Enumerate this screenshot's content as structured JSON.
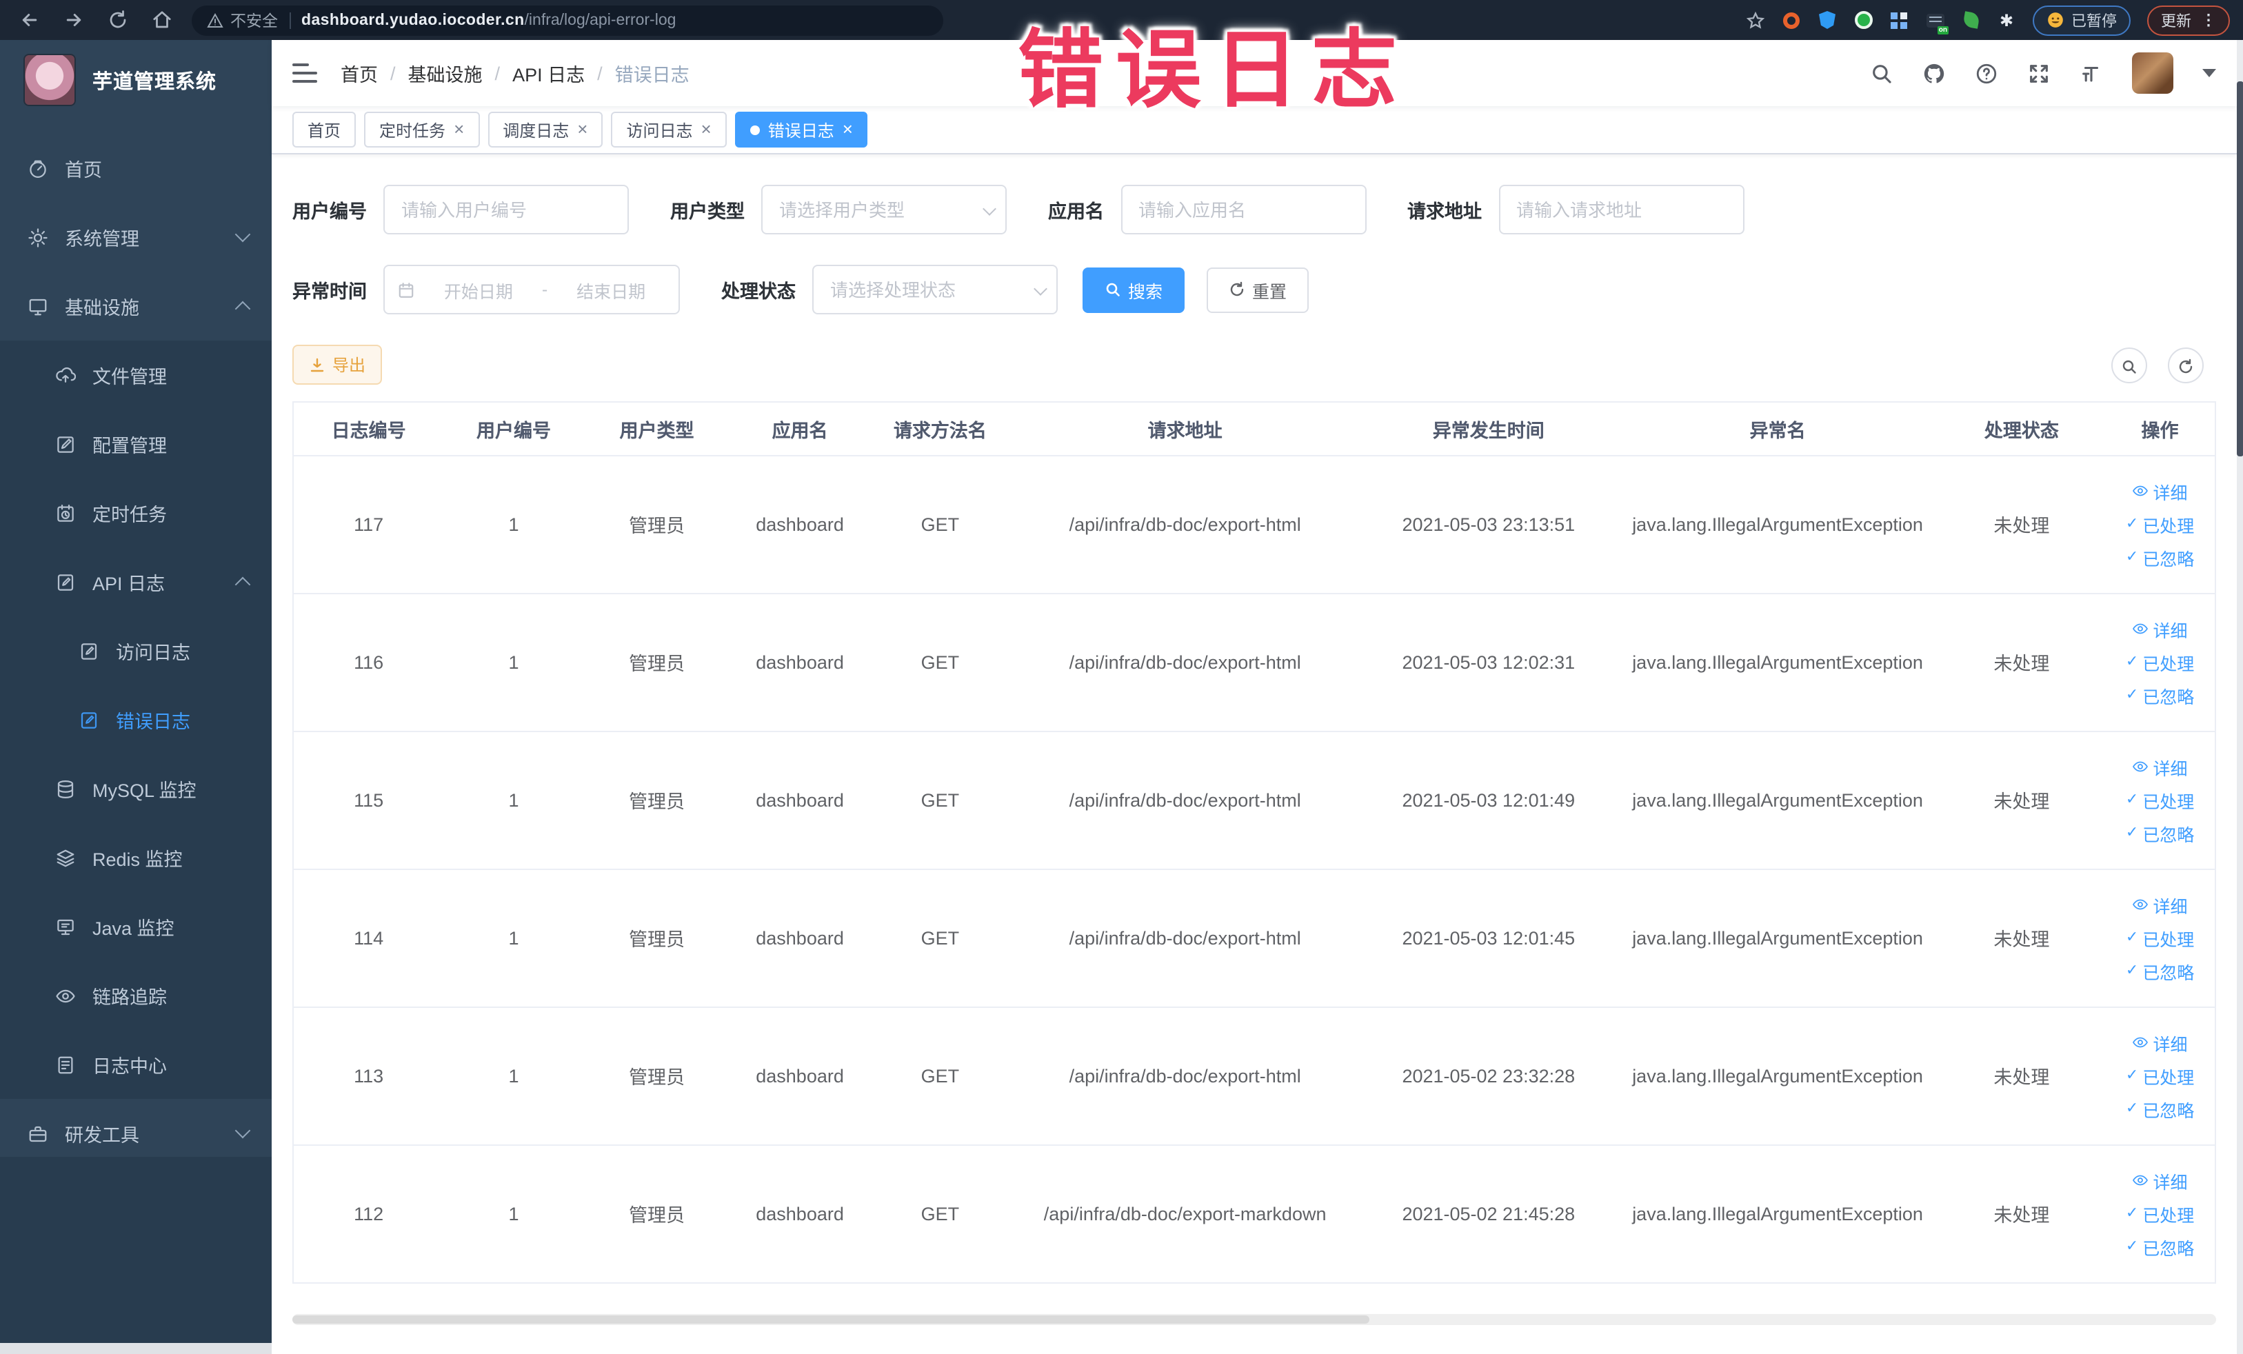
{
  "colors": {
    "accent": "#409eff",
    "warning": "#e6a23c",
    "annotation": "#ec3a5e",
    "sidebar_bg": "#2f4458",
    "submenu_bg": "#283c4f",
    "browser_bar_bg": "#1c2634"
  },
  "annotation": {
    "text": "错误日志"
  },
  "browser": {
    "security_label": "不安全",
    "url_domain": "dashboard.yudao.iocoder.cn",
    "url_path": "/infra/log/api-error-log",
    "paused_badge": "已暂停",
    "update_label": "更新"
  },
  "sidebar": {
    "logo_title": "芋道管理系统",
    "items": [
      {
        "label": "首页",
        "icon": "dashboard-icon",
        "depth": 0
      },
      {
        "label": "系统管理",
        "icon": "gear-icon",
        "depth": 0,
        "arrow": "down"
      },
      {
        "label": "基础设施",
        "icon": "monitor-icon",
        "depth": 0,
        "arrow": "up"
      },
      {
        "label": "文件管理",
        "icon": "upload-icon",
        "depth": 1,
        "sub": true
      },
      {
        "label": "配置管理",
        "icon": "edit-icon",
        "depth": 1,
        "sub": true
      },
      {
        "label": "定时任务",
        "icon": "task-icon",
        "depth": 1,
        "sub": true
      },
      {
        "label": "API 日志",
        "icon": "log-icon",
        "depth": 1,
        "sub": true,
        "arrow": "up"
      },
      {
        "label": "访问日志",
        "icon": "log-icon",
        "depth": 2,
        "sub": true
      },
      {
        "label": "错误日志",
        "icon": "log-icon",
        "depth": 2,
        "sub": true,
        "active": true
      },
      {
        "label": "MySQL 监控",
        "icon": "database-icon",
        "depth": 1,
        "sub": true
      },
      {
        "label": "Redis 监控",
        "icon": "layers-icon",
        "depth": 1,
        "sub": true
      },
      {
        "label": "Java 监控",
        "icon": "java-icon",
        "depth": 1,
        "sub": true
      },
      {
        "label": "链路追踪",
        "icon": "trace-icon",
        "depth": 1,
        "sub": true
      },
      {
        "label": "日志中心",
        "icon": "log-center-icon",
        "depth": 1,
        "sub": true
      },
      {
        "label": "研发工具",
        "icon": "toolbox-icon",
        "depth": 0,
        "arrow": "down"
      }
    ]
  },
  "breadcrumb": [
    "首页",
    "基础设施",
    "API 日志",
    "错误日志"
  ],
  "tabs": [
    {
      "label": "首页",
      "closable": false,
      "active": false
    },
    {
      "label": "定时任务",
      "closable": true,
      "active": false
    },
    {
      "label": "调度日志",
      "closable": true,
      "active": false
    },
    {
      "label": "访问日志",
      "closable": true,
      "active": false
    },
    {
      "label": "错误日志",
      "closable": true,
      "active": true
    }
  ],
  "filters": {
    "user_id_label": "用户编号",
    "user_id_placeholder": "请输入用户编号",
    "user_type_label": "用户类型",
    "user_type_placeholder": "请选择用户类型",
    "app_name_label": "应用名",
    "app_name_placeholder": "请输入应用名",
    "request_url_label": "请求地址",
    "request_url_placeholder": "请输入请求地址",
    "exception_time_label": "异常时间",
    "start_date_placeholder": "开始日期",
    "range_separator": "-",
    "end_date_placeholder": "结束日期",
    "process_status_label": "处理状态",
    "process_status_placeholder": "请选择处理状态",
    "search_button": "搜索",
    "reset_button": "重置"
  },
  "toolbar": {
    "export_label": "导出"
  },
  "table": {
    "columns": [
      {
        "label": "日志编号",
        "key": "id",
        "width": "7.8%"
      },
      {
        "label": "用户编号",
        "key": "user_id",
        "width": "7.3%"
      },
      {
        "label": "用户类型",
        "key": "user_type",
        "width": "7.6%"
      },
      {
        "label": "应用名",
        "key": "app",
        "width": "7.3%"
      },
      {
        "label": "请求方法名",
        "key": "method",
        "width": "7.3%"
      },
      {
        "label": "请求地址",
        "key": "url",
        "width": "18.2%"
      },
      {
        "label": "异常发生时间",
        "key": "time",
        "width": "13.4%"
      },
      {
        "label": "异常名",
        "key": "exception",
        "width": "16.7%"
      },
      {
        "label": "处理状态",
        "key": "status",
        "width": "8.7%"
      },
      {
        "label": "操作",
        "key": "actions",
        "width": "5.7%"
      }
    ],
    "row_actions": [
      "详细",
      "已处理",
      "已忽略"
    ],
    "rows": [
      {
        "id": "117",
        "user_id": "1",
        "user_type": "管理员",
        "app": "dashboard",
        "method": "GET",
        "url": "/api/infra/db-doc/export-html",
        "time": "2021-05-03 23:13:51",
        "exception": "java.lang.IllegalArgumentException",
        "status": "未处理"
      },
      {
        "id": "116",
        "user_id": "1",
        "user_type": "管理员",
        "app": "dashboard",
        "method": "GET",
        "url": "/api/infra/db-doc/export-html",
        "time": "2021-05-03 12:02:31",
        "exception": "java.lang.IllegalArgumentException",
        "status": "未处理"
      },
      {
        "id": "115",
        "user_id": "1",
        "user_type": "管理员",
        "app": "dashboard",
        "method": "GET",
        "url": "/api/infra/db-doc/export-html",
        "time": "2021-05-03 12:01:49",
        "exception": "java.lang.IllegalArgumentException",
        "status": "未处理"
      },
      {
        "id": "114",
        "user_id": "1",
        "user_type": "管理员",
        "app": "dashboard",
        "method": "GET",
        "url": "/api/infra/db-doc/export-html",
        "time": "2021-05-03 12:01:45",
        "exception": "java.lang.IllegalArgumentException",
        "status": "未处理"
      },
      {
        "id": "113",
        "user_id": "1",
        "user_type": "管理员",
        "app": "dashboard",
        "method": "GET",
        "url": "/api/infra/db-doc/export-html",
        "time": "2021-05-02 23:32:28",
        "exception": "java.lang.IllegalArgumentException",
        "status": "未处理"
      },
      {
        "id": "112",
        "user_id": "1",
        "user_type": "管理员",
        "app": "dashboard",
        "method": "GET",
        "url": "/api/infra/db-doc/export-markdown",
        "time": "2021-05-02 21:45:28",
        "exception": "java.lang.IllegalArgumentException",
        "status": "未处理"
      }
    ]
  }
}
